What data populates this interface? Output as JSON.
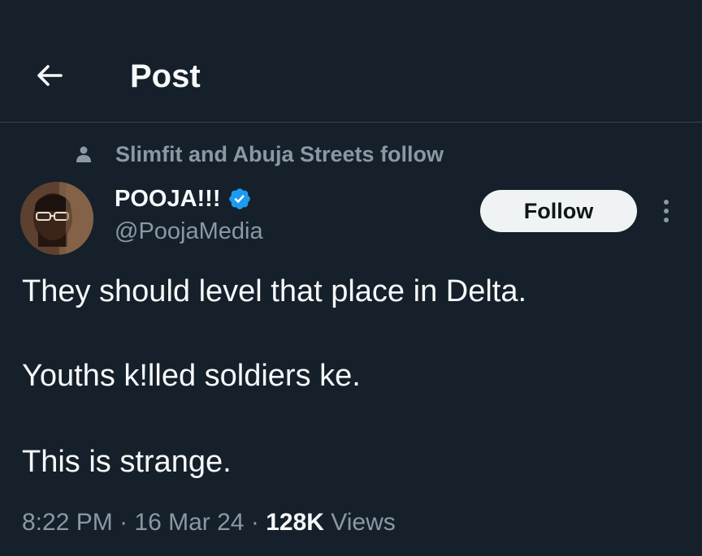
{
  "header": {
    "title": "Post",
    "back_icon": "arrow-left-icon"
  },
  "social_context": {
    "icon": "person-icon",
    "text": "Slimfit and Abuja Streets follow"
  },
  "author": {
    "name": "POOJA!!!",
    "handle": "@PoojaMedia",
    "verified": true,
    "verified_color": "#1d9bf0"
  },
  "follow_button": {
    "label": "Follow"
  },
  "more_icon": "more-vertical-icon",
  "post": {
    "lines": [
      "They should level that place in Delta.",
      "Youths k!lled soldiers ke.",
      "This is strange."
    ]
  },
  "meta": {
    "time": "8:22 PM",
    "date": "16 Mar 24",
    "views_count": "128K",
    "views_label": "Views",
    "separator": "·"
  },
  "colors": {
    "background": "#15202b",
    "text_primary": "#f7f9f9",
    "text_secondary": "#8b98a5",
    "divider": "#38444d",
    "button_bg": "#eff3f4"
  }
}
